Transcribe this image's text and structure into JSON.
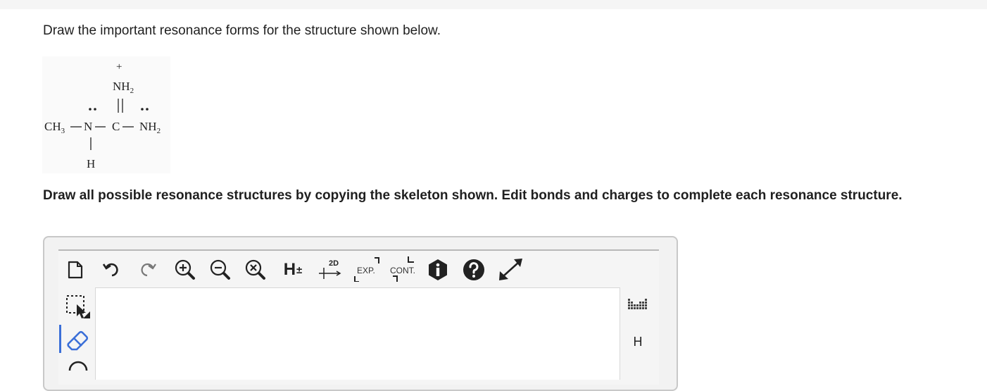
{
  "question": {
    "prompt": "Draw the important resonance forms for the structure shown below.",
    "instructions": "Draw all possible resonance structures by copying the skeleton shown. Edit bonds and charges to complete each resonance structure."
  },
  "molecule": {
    "plus": "+",
    "top_group": "NH",
    "top_sub": "2",
    "left_group": "CH",
    "left_sub": "3",
    "n_atom": "N",
    "c_atom": "C",
    "right_group": "NH",
    "right_sub": "2",
    "bottom_atom": "H"
  },
  "toolbar": {
    "hydrogen_label": "H",
    "hydrogen_sign": "±",
    "twod_label": "2D",
    "exp_label": "EXP.",
    "cont_label": "CONT."
  },
  "right_panel": {
    "h_label": "H"
  },
  "colors": {
    "accent": "#3b6fd8",
    "icon": "#222222"
  }
}
